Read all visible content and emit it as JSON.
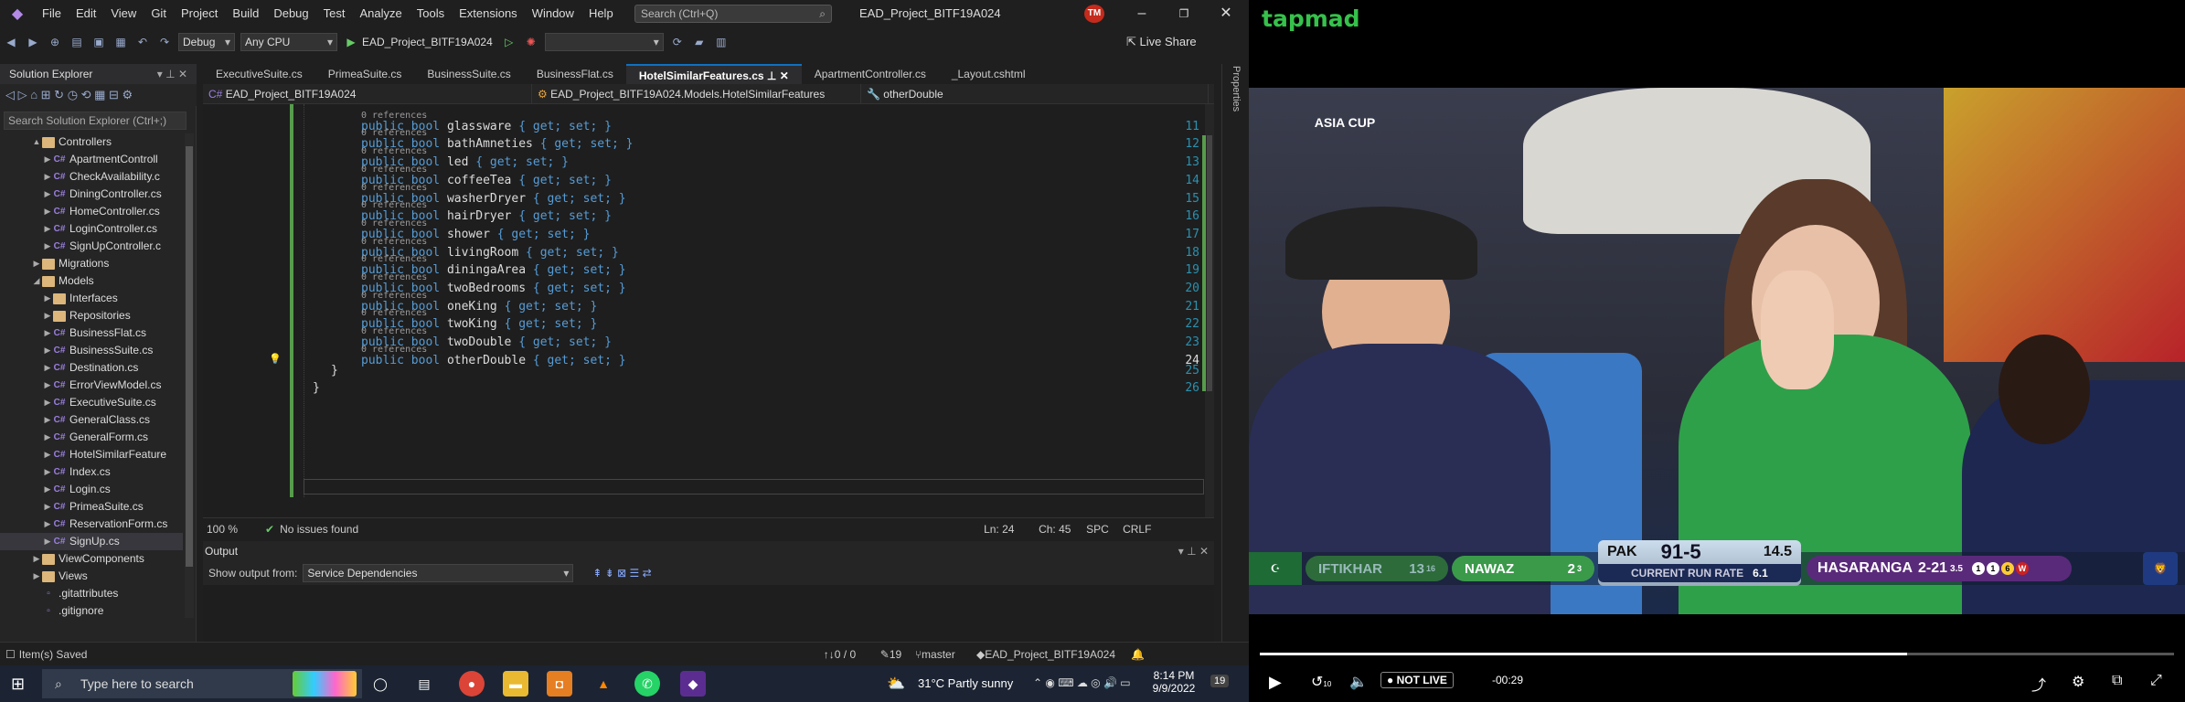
{
  "vs": {
    "menu": [
      "File",
      "Edit",
      "View",
      "Git",
      "Project",
      "Build",
      "Debug",
      "Test",
      "Analyze",
      "Tools",
      "Extensions",
      "Window",
      "Help"
    ],
    "search_placeholder": "Search (Ctrl+Q)",
    "window_title": "EAD_Project_BITF19A024",
    "avatar": "TM",
    "toolbar": {
      "config": "Debug",
      "platform": "Any CPU",
      "start_target": "EAD_Project_BITF19A024",
      "live_share": "Live Share"
    },
    "solution_explorer": {
      "title": "Solution Explorer",
      "search_placeholder": "Search Solution Explorer (Ctrl+;)",
      "items": [
        {
          "label": "Controllers",
          "type": "folder",
          "level": 2,
          "arrow": "▲"
        },
        {
          "label": "ApartmentControll",
          "type": "cs",
          "level": 3,
          "arrow": "▶"
        },
        {
          "label": "CheckAvailability.c",
          "type": "cs",
          "level": 3,
          "arrow": "▶"
        },
        {
          "label": "DiningController.cs",
          "type": "cs",
          "level": 3,
          "arrow": "▶"
        },
        {
          "label": "HomeController.cs",
          "type": "cs",
          "level": 3,
          "arrow": "▶"
        },
        {
          "label": "LoginController.cs",
          "type": "cs",
          "level": 3,
          "arrow": "▶"
        },
        {
          "label": "SignUpController.c",
          "type": "cs",
          "level": 3,
          "arrow": "▶"
        },
        {
          "label": "Migrations",
          "type": "folder",
          "level": 2,
          "arrow": "▶"
        },
        {
          "label": "Models",
          "type": "folder",
          "level": 2,
          "arrow": "◢"
        },
        {
          "label": "Interfaces",
          "type": "folder",
          "level": 3,
          "arrow": "▶"
        },
        {
          "label": "Repositories",
          "type": "folder",
          "level": 3,
          "arrow": "▶"
        },
        {
          "label": "BusinessFlat.cs",
          "type": "cs",
          "level": 3,
          "arrow": "▶"
        },
        {
          "label": "BusinessSuite.cs",
          "type": "cs",
          "level": 3,
          "arrow": "▶"
        },
        {
          "label": "Destination.cs",
          "type": "cs",
          "level": 3,
          "arrow": "▶"
        },
        {
          "label": "ErrorViewModel.cs",
          "type": "cs",
          "level": 3,
          "arrow": "▶"
        },
        {
          "label": "ExecutiveSuite.cs",
          "type": "cs",
          "level": 3,
          "arrow": "▶"
        },
        {
          "label": "GeneralClass.cs",
          "type": "cs",
          "level": 3,
          "arrow": "▶"
        },
        {
          "label": "GeneralForm.cs",
          "type": "cs",
          "level": 3,
          "arrow": "▶"
        },
        {
          "label": "HotelSimilarFeature",
          "type": "cs",
          "level": 3,
          "arrow": "▶"
        },
        {
          "label": "Index.cs",
          "type": "cs",
          "level": 3,
          "arrow": "▶"
        },
        {
          "label": "Login.cs",
          "type": "cs",
          "level": 3,
          "arrow": "▶"
        },
        {
          "label": "PrimeaSuite.cs",
          "type": "cs",
          "level": 3,
          "arrow": "▶"
        },
        {
          "label": "ReservationForm.cs",
          "type": "cs",
          "level": 3,
          "arrow": "▶"
        },
        {
          "label": "SignUp.cs",
          "type": "cs",
          "level": 3,
          "arrow": "▶",
          "selected": true
        },
        {
          "label": "ViewComponents",
          "type": "folder",
          "level": 2,
          "arrow": "▶"
        },
        {
          "label": "Views",
          "type": "folder",
          "level": 2,
          "arrow": "▶"
        },
        {
          "label": ".gitattributes",
          "type": "file",
          "level": 2,
          "arrow": ""
        },
        {
          "label": ".gitignore",
          "type": "file",
          "level": 2,
          "arrow": ""
        }
      ]
    },
    "tabs": [
      {
        "label": "ExecutiveSuite.cs",
        "active": false
      },
      {
        "label": "PrimeaSuite.cs",
        "active": false
      },
      {
        "label": "BusinessSuite.cs",
        "active": false
      },
      {
        "label": "BusinessFlat.cs",
        "active": false
      },
      {
        "label": "HotelSimilarFeatures.cs",
        "active": true
      },
      {
        "label": "ApartmentController.cs",
        "active": false
      },
      {
        "label": "_Layout.cshtml",
        "active": false
      }
    ],
    "navbar": {
      "project": "EAD_Project_BITF19A024",
      "type": "EAD_Project_BITF19A024.Models.HotelSimilarFeatures",
      "member": "otherDouble"
    },
    "code": {
      "refs_label": "0 references",
      "lines": [
        {
          "n": "11",
          "prop": "glassware"
        },
        {
          "n": "12",
          "prop": "bathAmneties"
        },
        {
          "n": "13",
          "prop": "led"
        },
        {
          "n": "14",
          "prop": "coffeeTea"
        },
        {
          "n": "15",
          "prop": "washerDryer"
        },
        {
          "n": "16",
          "prop": "hairDryer"
        },
        {
          "n": "17",
          "prop": "shower"
        },
        {
          "n": "18",
          "prop": "livingRoom"
        },
        {
          "n": "19",
          "prop": "diningaArea"
        },
        {
          "n": "20",
          "prop": "twoBedrooms"
        },
        {
          "n": "21",
          "prop": "oneKing"
        },
        {
          "n": "22",
          "prop": "twoKing"
        },
        {
          "n": "23",
          "prop": "twoDouble"
        },
        {
          "n": "24",
          "prop": "otherDouble"
        }
      ],
      "kw_public": "public",
      "kw_bool": "bool",
      "accessors": "{ get; set; }",
      "line25": "25",
      "line25_text": "}",
      "line26": "26",
      "line26_text": "}"
    },
    "editor_status": {
      "zoom": "100 %",
      "issues": "No issues found",
      "ln": "Ln: 24",
      "ch": "Ch: 45",
      "enc": "SPC",
      "eol": "CRLF"
    },
    "output": {
      "title": "Output",
      "show_from_label": "Show output from:",
      "source": "Service Dependencies"
    },
    "properties_label": "Properties",
    "statusbar": {
      "left": "Item(s) Saved",
      "errors": "0 / 0",
      "changes": "19",
      "branch": "master",
      "repo": "EAD_Project_BITF19A024"
    }
  },
  "taskbar": {
    "search_placeholder": "Type here to search",
    "weather": "31°C  Partly sunny",
    "time": "8:14 PM",
    "date": "9/9/2022",
    "notif_count": "19"
  },
  "video": {
    "brand": "tapmad",
    "overlay_logo": "ASIA CUP",
    "score": {
      "bat1_name": "IFTIKHAR",
      "bat1_score": "13",
      "bat1_balls": "16",
      "bat2_name": "NAWAZ",
      "bat2_score": "2",
      "bat2_balls": "3",
      "team": "PAK",
      "runs_wkts": "91-5",
      "overs": "14.5",
      "crr_label": "CURRENT RUN RATE",
      "crr": "6.1",
      "bowler": "HASARANGA",
      "bowler_figures": "2-21",
      "bowler_overs": "3.5",
      "this_over": [
        "1",
        "1",
        "6",
        "W"
      ]
    },
    "progress_fraction": 0.708,
    "not_live": "NOT LIVE",
    "time_remaining": "-00:29",
    "skip": "10"
  }
}
